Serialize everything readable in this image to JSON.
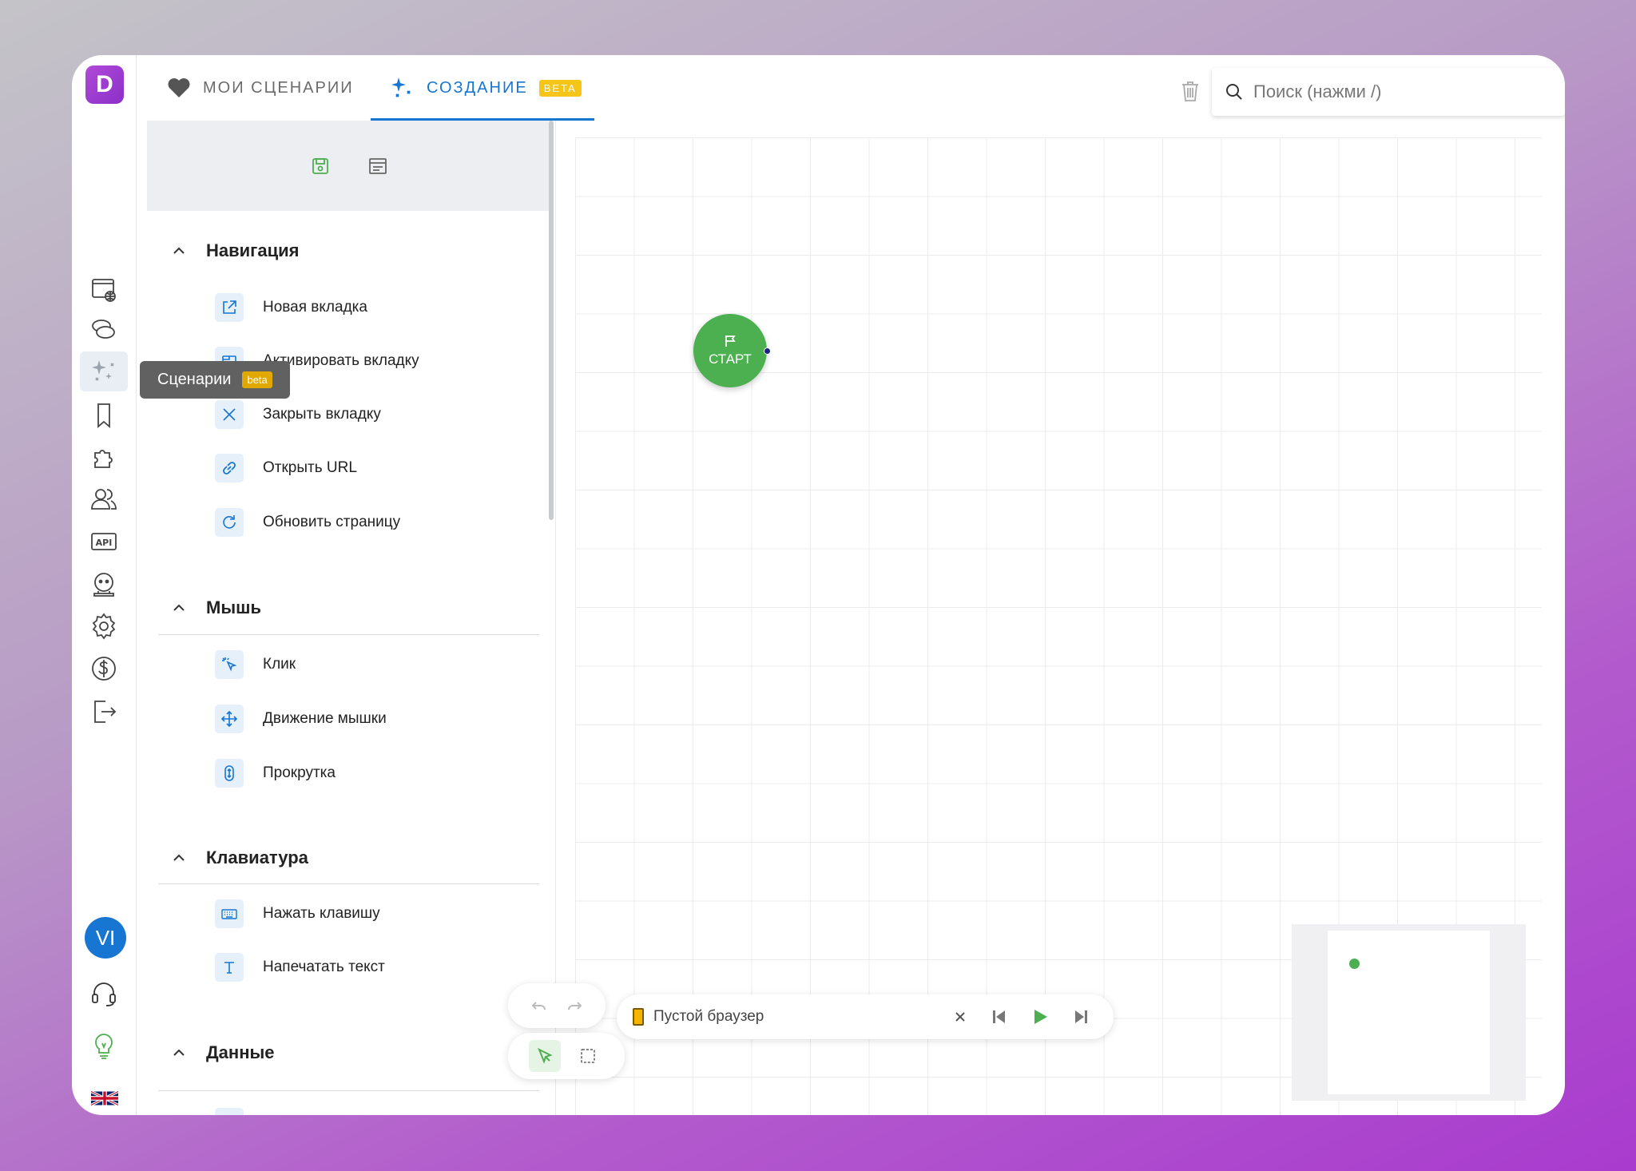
{
  "app": {
    "logo_letter": "D"
  },
  "tabs": [
    {
      "label": "МОИ СЦЕНАРИИ",
      "icon": "heart-icon"
    },
    {
      "label": "СОЗДАНИЕ",
      "icon": "sparkle-icon",
      "badge": "beta",
      "active": true
    }
  ],
  "search": {
    "placeholder": "Поиск (нажми /)"
  },
  "tooltip": {
    "label": "Сценарии",
    "badge": "beta"
  },
  "sidebar_icons": [
    "browser-globe-icon",
    "chat-icon",
    "sparkle-icon",
    "bookmark-icon",
    "puzzle-icon",
    "users-icon",
    "api-icon",
    "robot-icon",
    "gear-icon",
    "dollar-icon",
    "logout-icon"
  ],
  "sidebar_icon_api_text": "API",
  "user": {
    "initials": "VI"
  },
  "sections": [
    {
      "title": "Навигация",
      "items": [
        {
          "label": "Новая вкладка",
          "icon": "external-link-icon"
        },
        {
          "label": "Активировать вкладку",
          "icon": "tab-icon"
        },
        {
          "label": "Закрыть вкладку",
          "icon": "close-icon"
        },
        {
          "label": "Открыть URL",
          "icon": "link-icon"
        },
        {
          "label": "Обновить страницу",
          "icon": "refresh-icon"
        }
      ]
    },
    {
      "title": "Мышь",
      "items": [
        {
          "label": "Клик",
          "icon": "cursor-click-icon"
        },
        {
          "label": "Движение мышки",
          "icon": "move-icon"
        },
        {
          "label": "Прокрутка",
          "icon": "scroll-icon"
        }
      ]
    },
    {
      "title": "Клавиатура",
      "items": [
        {
          "label": "Нажать клавишу",
          "icon": "keyboard-icon"
        },
        {
          "label": "Напечатать текст",
          "icon": "text-icon"
        }
      ]
    },
    {
      "title": "Данные",
      "items": []
    }
  ],
  "canvas": {
    "start_node_label": "СТАРТ"
  },
  "runner": {
    "browser_label": "Пустой браузер"
  },
  "colors": {
    "accent": "#1676d2",
    "start": "#4caf50",
    "beta": "#f5c518"
  }
}
